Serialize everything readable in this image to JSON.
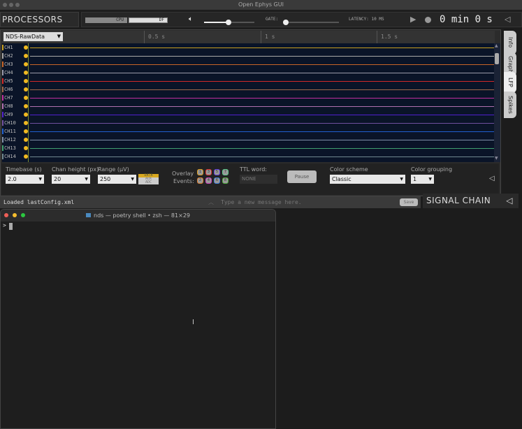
{
  "window": {
    "title": "Open Ephys GUI"
  },
  "topbar": {
    "processors": "PROCESSORS",
    "cpu_label": "CPU",
    "df_label": "DF",
    "volume_icon": "speaker-icon",
    "gate_label": "GATE:",
    "latency": "LATENCY: 10 MS",
    "time": "0 min 0 s",
    "play_icon": "play-icon",
    "record_icon": "record-icon",
    "volume_level": 0.6,
    "gate_level": 0.05
  },
  "viewer": {
    "datasource": "NDS-RawData",
    "ticks": [
      "0.5 s",
      "1 s",
      "1.5 s"
    ],
    "channels": [
      {
        "label": "CH1",
        "color": "#c8a020"
      },
      {
        "label": "CH2",
        "color": "#a8a8a8"
      },
      {
        "label": "CH3",
        "color": "#c86428"
      },
      {
        "label": "CH4",
        "color": "#9a9aaa"
      },
      {
        "label": "CH5",
        "color": "#d02828"
      },
      {
        "label": "CH6",
        "color": "#a06848"
      },
      {
        "label": "CH7",
        "color": "#c030a0"
      },
      {
        "label": "CH8",
        "color": "#b070b0"
      },
      {
        "label": "CH9",
        "color": "#5020d0"
      },
      {
        "label": "CH10",
        "color": "#7050a0"
      },
      {
        "label": "CH11",
        "color": "#2060d0"
      },
      {
        "label": "CH12",
        "color": "#8090a8"
      },
      {
        "label": "CH13",
        "color": "#40a070"
      },
      {
        "label": "CH14",
        "color": "#708890"
      }
    ],
    "tabs": [
      "Info",
      "Graph",
      "LFP",
      "Spikes"
    ]
  },
  "controls": {
    "timebase_label": "Timebase (s)",
    "timebase": "2.0",
    "chan_height_label": "Chan height (px)",
    "chan_height": "20",
    "range_label": "Range (µV)",
    "range": "250",
    "types": [
      "DATA",
      "AUX",
      "ADC"
    ],
    "overlay_label": "Overlay",
    "events_label": "Events:",
    "events": [
      {
        "n": "1",
        "c": "#e0a020"
      },
      {
        "n": "3",
        "c": "#e03030"
      },
      {
        "n": "5",
        "c": "#6040e0"
      },
      {
        "n": "7",
        "c": "#60d090"
      },
      {
        "n": "2",
        "c": "#e08030"
      },
      {
        "n": "4",
        "c": "#d040c0"
      },
      {
        "n": "6",
        "c": "#4080e0"
      },
      {
        "n": "8",
        "c": "#50b040"
      }
    ],
    "ttl_label": "TTL word:",
    "ttl": "NONE",
    "pause": "Pause",
    "color_scheme_label": "Color scheme",
    "color_scheme": "Classic",
    "color_grouping_label": "Color grouping",
    "color_grouping": "1"
  },
  "status": {
    "message": "Loaded lastConfig.xml",
    "input_placeholder": "Type a new message here.",
    "save": "Save"
  },
  "signal_chain": "SIGNAL CHAIN",
  "terminal": {
    "title": "nds — poetry shell • zsh — 81×29",
    "prompt": ">"
  }
}
